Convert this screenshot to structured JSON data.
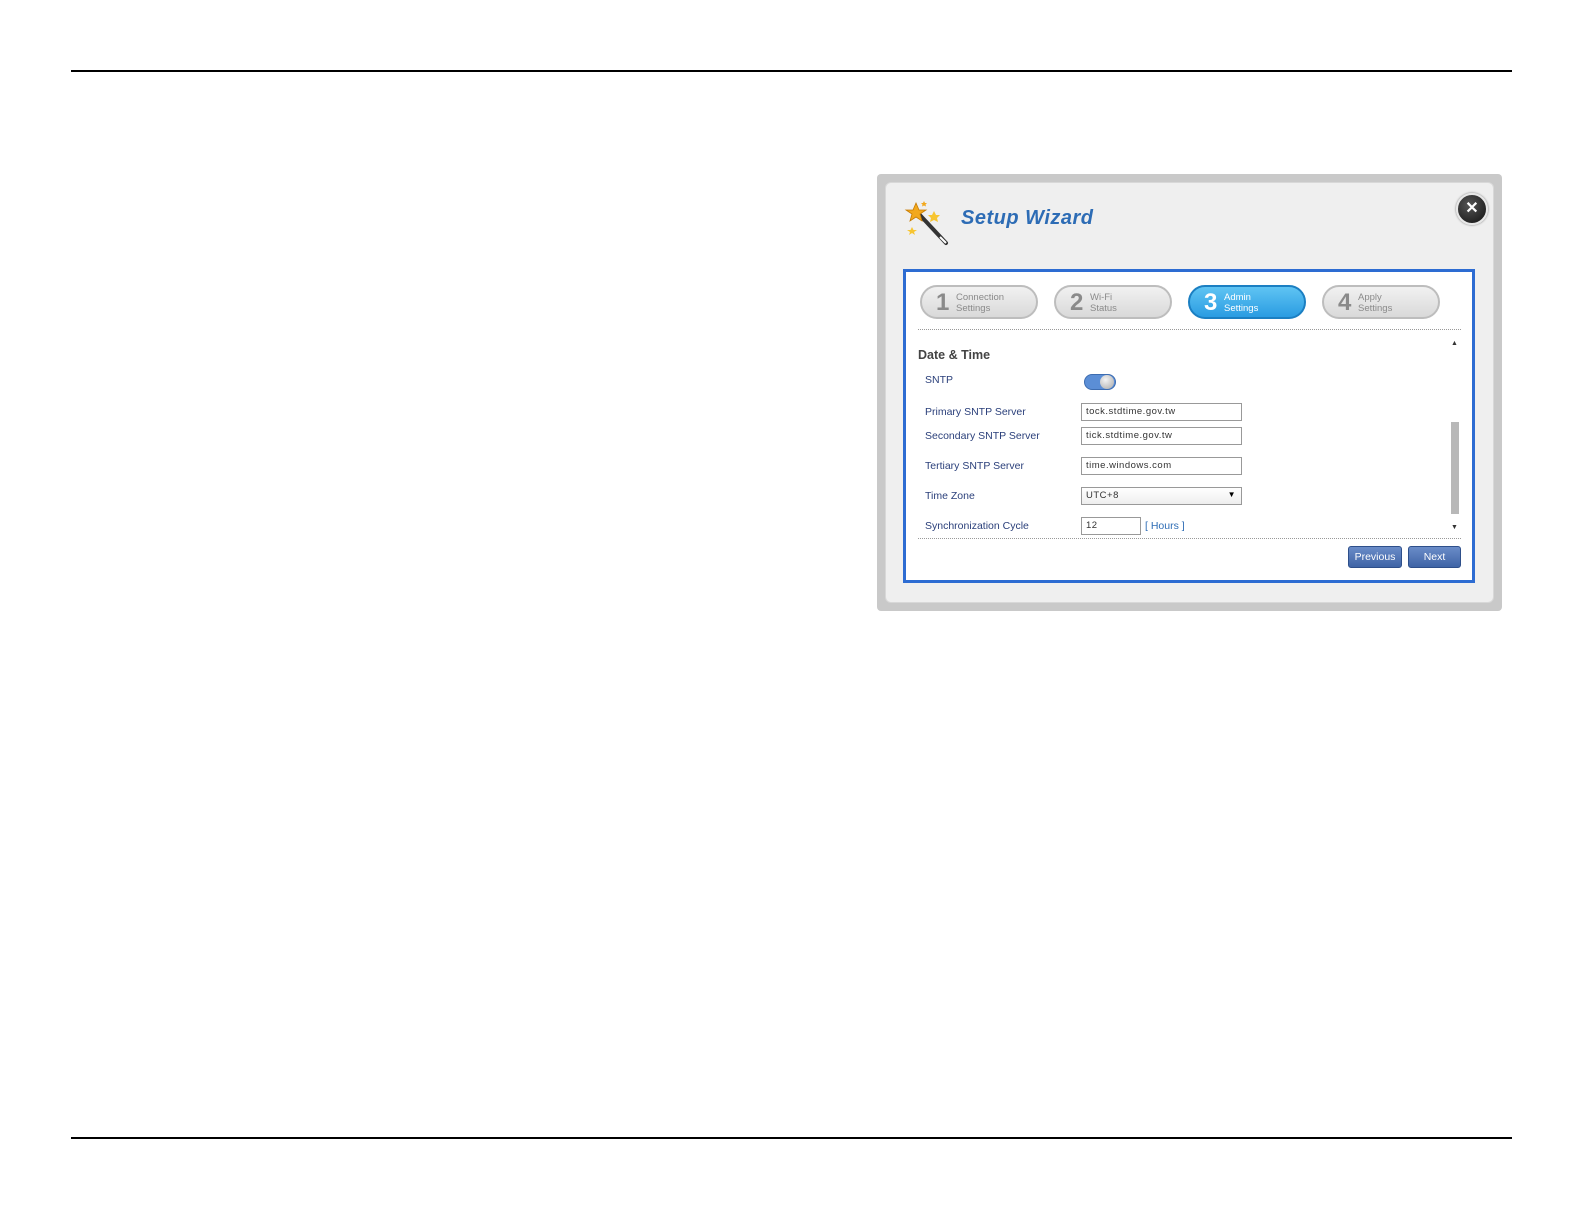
{
  "wizard": {
    "title": "Setup Wizard",
    "close_icon": "close-icon",
    "wand_icon": "magic-wand-icon"
  },
  "steps": [
    {
      "num": "1",
      "label1": "Connection",
      "label2": "Settings",
      "active": false
    },
    {
      "num": "2",
      "label1": "Wi-Fi",
      "label2": "Status",
      "active": false
    },
    {
      "num": "3",
      "label1": "Admin",
      "label2": "Settings",
      "active": true
    },
    {
      "num": "4",
      "label1": "Apply",
      "label2": "Settings",
      "active": false
    }
  ],
  "section": {
    "title": "Date & Time",
    "sntp_label": "SNTP",
    "sntp_enabled": true,
    "primary_label": "Primary SNTP Server",
    "primary_value": "tock.stdtime.gov.tw",
    "secondary_label": "Secondary SNTP Server",
    "secondary_value": "tick.stdtime.gov.tw",
    "tertiary_label": "Tertiary SNTP Server",
    "tertiary_value": "time.windows.com",
    "timezone_label": "Time Zone",
    "timezone_value": "UTC+8",
    "sync_label": "Synchronization Cycle",
    "sync_value": "12",
    "sync_unit": "[ Hours ]"
  },
  "buttons": {
    "previous": "Previous",
    "next": "Next"
  },
  "colors": {
    "accent": "#2d6cd2",
    "title": "#2d6cb5",
    "active_step": "#2a9ce2"
  }
}
